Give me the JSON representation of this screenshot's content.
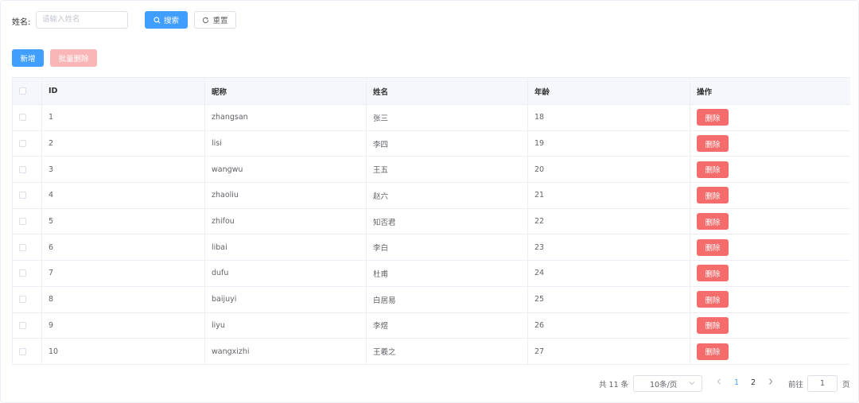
{
  "search": {
    "label": "姓名:",
    "placeholder": "请输入姓名",
    "search_button": "搜索",
    "reset_button": "重置"
  },
  "toolbar": {
    "add_button": "新增",
    "batch_delete_button": "批量删除"
  },
  "table": {
    "headers": [
      "ID",
      "昵称",
      "姓名",
      "年龄",
      "操作"
    ],
    "delete_label": "删除",
    "rows": [
      {
        "id": "1",
        "nickname": "zhangsan",
        "name": "张三",
        "age": "18"
      },
      {
        "id": "2",
        "nickname": "lisi",
        "name": "李四",
        "age": "19"
      },
      {
        "id": "3",
        "nickname": "wangwu",
        "name": "王五",
        "age": "20"
      },
      {
        "id": "4",
        "nickname": "zhaoliu",
        "name": "赵六",
        "age": "21"
      },
      {
        "id": "5",
        "nickname": "zhifou",
        "name": "知否君",
        "age": "22"
      },
      {
        "id": "6",
        "nickname": "libai",
        "name": "李白",
        "age": "23"
      },
      {
        "id": "7",
        "nickname": "dufu",
        "name": "杜甫",
        "age": "24"
      },
      {
        "id": "8",
        "nickname": "baijuyi",
        "name": "白居易",
        "age": "25"
      },
      {
        "id": "9",
        "nickname": "liyu",
        "name": "李煜",
        "age": "26"
      },
      {
        "id": "10",
        "nickname": "wangxizhi",
        "name": "王羲之",
        "age": "27"
      }
    ]
  },
  "pagination": {
    "total_text": "共 11 条",
    "page_size": "10条/页",
    "pages": [
      "1",
      "2"
    ],
    "current_page": "1",
    "goto_label": "前往",
    "goto_value": "1",
    "goto_unit": "页"
  },
  "colors": {
    "primary": "#409eff",
    "danger": "#f56c6c",
    "danger_disabled": "#fab6b6"
  }
}
